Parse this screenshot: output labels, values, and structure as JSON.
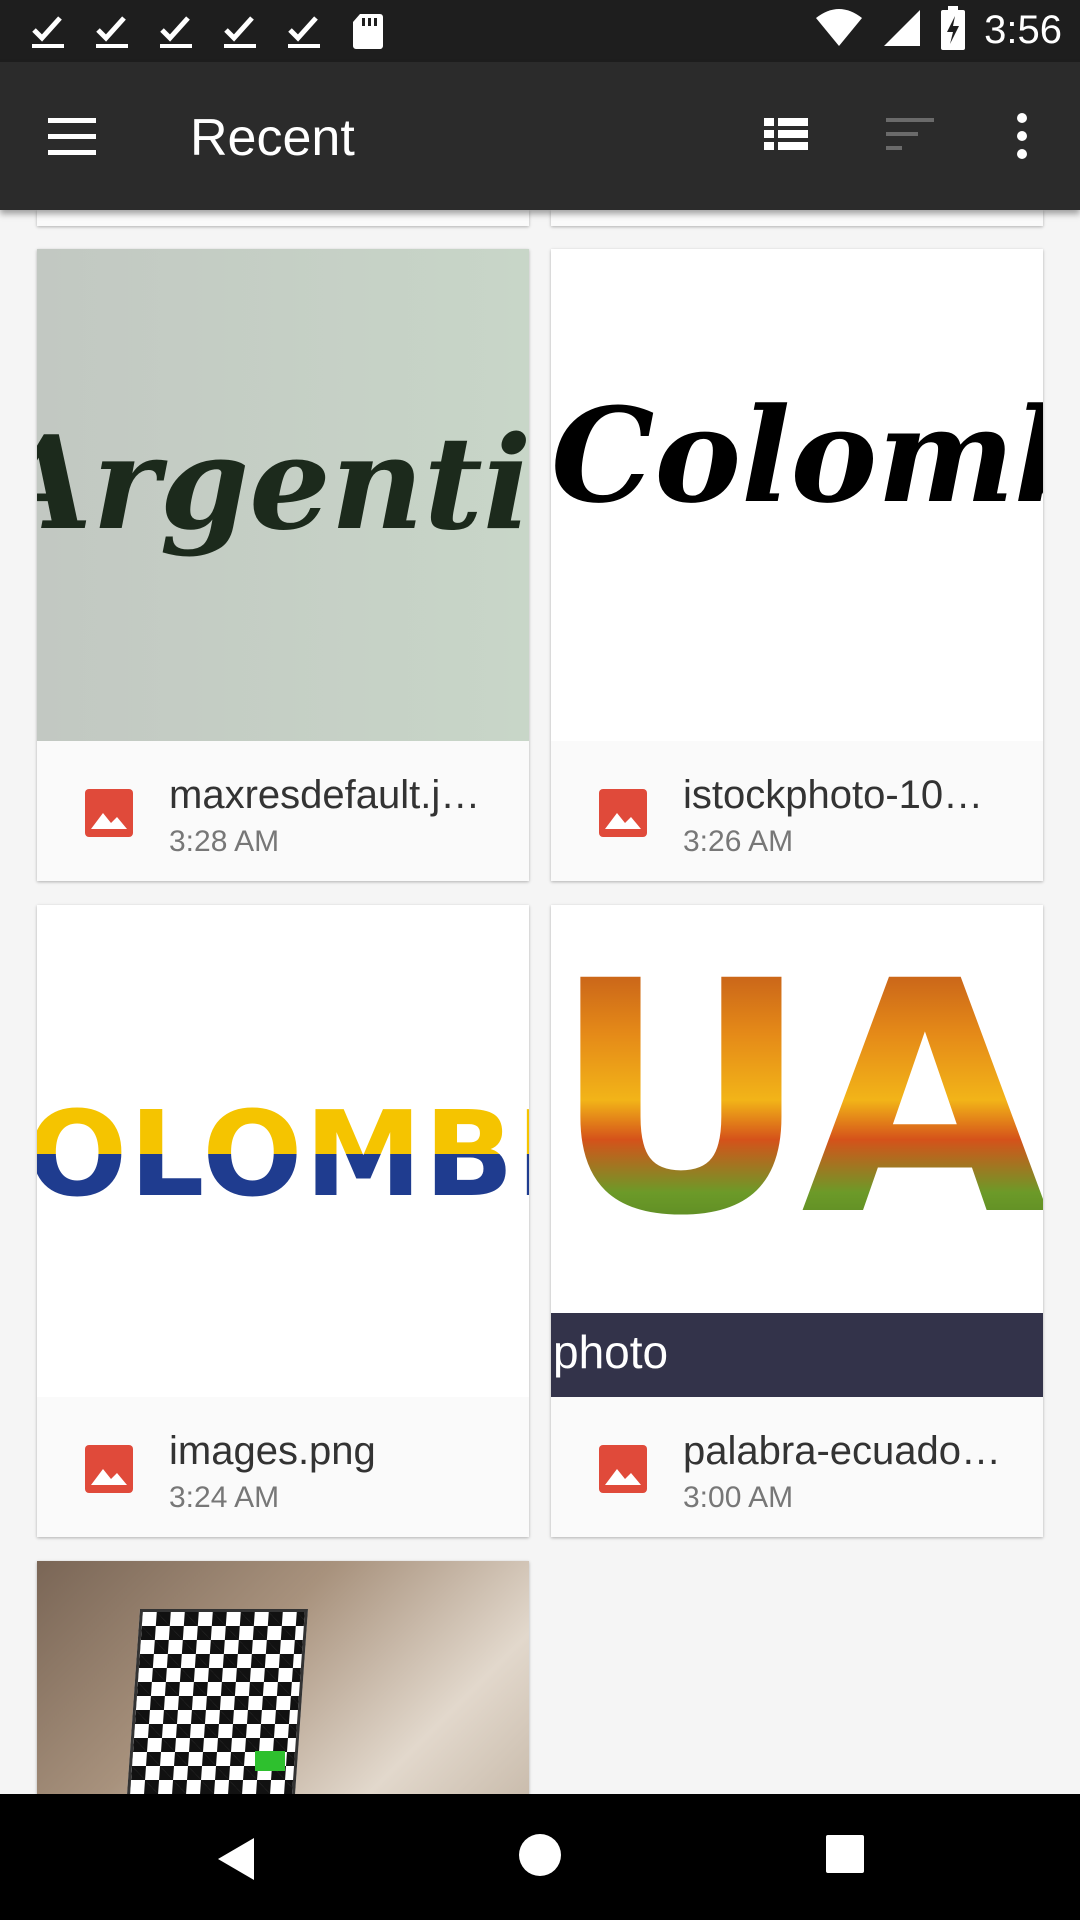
{
  "status_bar": {
    "time": "3:56",
    "left_icons": [
      "check-icon",
      "check-icon",
      "check-icon",
      "check-icon",
      "check-icon",
      "sd-card-icon"
    ],
    "right_icons": [
      "wifi-icon",
      "signal-icon",
      "battery-charging-icon"
    ]
  },
  "app_bar": {
    "title": "Recent",
    "icons": [
      "menu-icon",
      "list-view-icon",
      "sort-icon",
      "more-vert-icon"
    ]
  },
  "files": [
    {
      "name": "maxresdefault.j…",
      "time": "3:28 AM",
      "thumb_text": "Argentina"
    },
    {
      "name": "istockphoto-10…",
      "time": "3:26 AM",
      "thumb_text": "Colombia"
    },
    {
      "name": "images.png",
      "time": "3:24 AM",
      "thumb_text": "OLOMBIA"
    },
    {
      "name": "palabra-ecuado…",
      "time": "3:00 AM",
      "thumb_text": "UAD",
      "thumb_caption": "photo"
    },
    {
      "name": "",
      "time": ""
    }
  ],
  "nav_bar": {
    "icons": [
      "back-icon",
      "home-icon",
      "recents-icon"
    ]
  },
  "colors": {
    "image_icon": "#e04a3a",
    "app_bar": "#2b2b2b",
    "status_bar": "#1e1e1e"
  }
}
